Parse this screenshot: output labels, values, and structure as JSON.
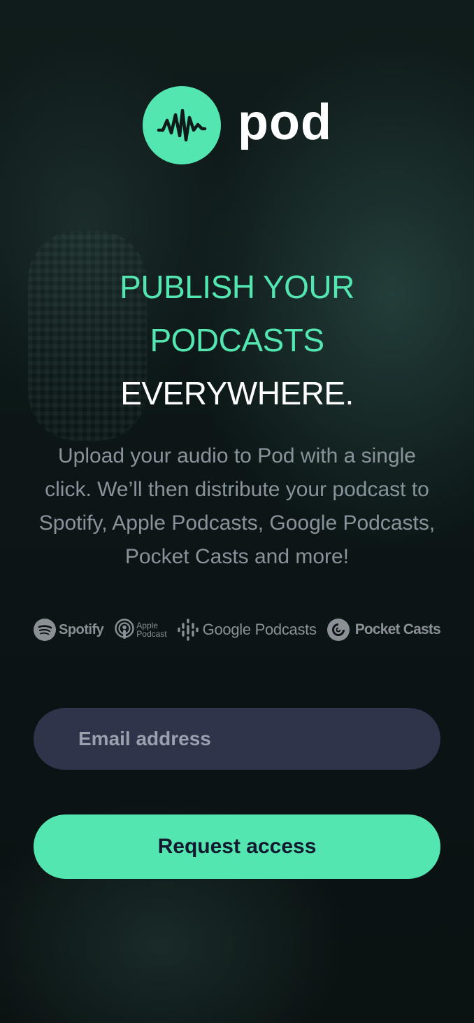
{
  "brand": {
    "name": "pod",
    "icon": "soundwave-icon",
    "accent_color": "#54e6b0"
  },
  "hero": {
    "headline_line1": "PUBLISH YOUR",
    "headline_line2": "PODCASTS",
    "headline_line3": "EVERYWHERE.",
    "description": "Upload your audio to Pod with a single click. We’ll then distribute your podcast to Spotify, Apple Podcasts, Google Podcasts, Pocket Casts and more!"
  },
  "platforms": {
    "spotify": "Spotify",
    "apple_line1": "Apple",
    "apple_line2": "Podcast",
    "google": "Google Podcasts",
    "pocket": "Pocket Casts"
  },
  "form": {
    "email_placeholder": "Email address",
    "email_value": "",
    "submit_label": "Request access",
    "input_bg_color": "#2e3449"
  }
}
